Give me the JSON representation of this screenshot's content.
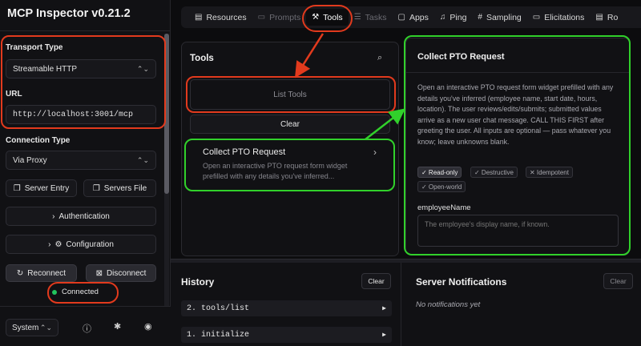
{
  "app": {
    "title": "MCP Inspector v0.21.2"
  },
  "sidebar": {
    "transport_label": "Transport Type",
    "transport_value": "Streamable HTTP",
    "url_label": "URL",
    "url_value": "http://localhost:3001/mcp",
    "connection_label": "Connection Type",
    "connection_value": "Via Proxy",
    "server_entry": "Server Entry",
    "servers_file": "Servers File",
    "authentication": "Authentication",
    "configuration": "Configuration",
    "reconnect": "Reconnect",
    "disconnect": "Disconnect",
    "status": "Connected",
    "theme_value": "System"
  },
  "tabs": [
    {
      "label": "Resources",
      "icon": "resources-icon",
      "glyph": "▤"
    },
    {
      "label": "Prompts",
      "icon": "prompts-icon",
      "glyph": "▭"
    },
    {
      "label": "Tools",
      "icon": "tools-icon",
      "glyph": "⚒"
    },
    {
      "label": "Tasks",
      "icon": "tasks-icon",
      "glyph": "☰"
    },
    {
      "label": "Apps",
      "icon": "apps-icon",
      "glyph": "▢"
    },
    {
      "label": "Ping",
      "icon": "ping-icon",
      "glyph": "♫"
    },
    {
      "label": "Sampling",
      "icon": "sampling-icon",
      "glyph": "#"
    },
    {
      "label": "Elicitations",
      "icon": "elicitations-icon",
      "glyph": "▭"
    },
    {
      "label": "Ro",
      "icon": "roots-icon",
      "glyph": "▤"
    }
  ],
  "tools_panel": {
    "title": "Tools",
    "list_tools": "List Tools",
    "clear": "Clear",
    "tool_name": "Collect PTO Request",
    "tool_preview": "Open an interactive PTO request form widget prefilled with any details you've inferred..."
  },
  "detail": {
    "title": "Collect PTO Request",
    "description": "Open an interactive PTO request form widget prefilled with any details you've inferred (employee name, start date, hours, location). The user reviews/edits/submits; submitted values arrive as a new user chat message. CALL THIS FIRST after greeting the user. All inputs are optional — pass whatever you know; leave unknowns blank.",
    "badges": [
      "✓ Read-only",
      "✓ Destructive",
      "✕ Idempotent",
      "✓ Open-world"
    ],
    "field_label": "employeeName",
    "field_placeholder": "The employee's display name, if known."
  },
  "history": {
    "title": "History",
    "clear": "Clear",
    "items": [
      "2. tools/list",
      "1. initialize"
    ]
  },
  "notifications": {
    "title": "Server Notifications",
    "clear": "Clear",
    "empty": "No notifications yet"
  },
  "colors": {
    "annotation_red": "#e23a1d",
    "annotation_green": "#31d12b",
    "status_green": "#22c55e"
  }
}
